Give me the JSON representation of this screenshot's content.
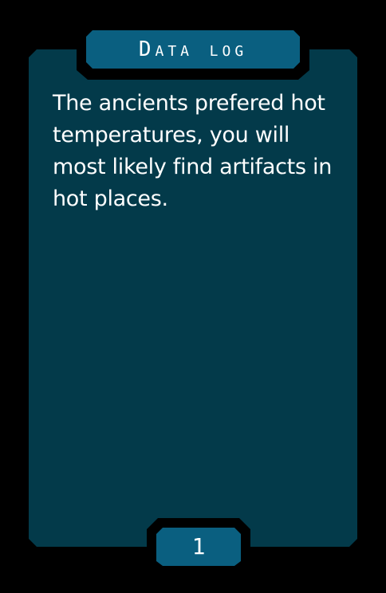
{
  "card": {
    "title": "Data log",
    "body": "The ancients prefered hot temperatures, you will most likely find artifacts in hot places.",
    "page_number": "1"
  },
  "colors": {
    "background": "#000000",
    "panel": "#033a4a",
    "tab": "#0a5f80",
    "text": "#ffffff"
  }
}
